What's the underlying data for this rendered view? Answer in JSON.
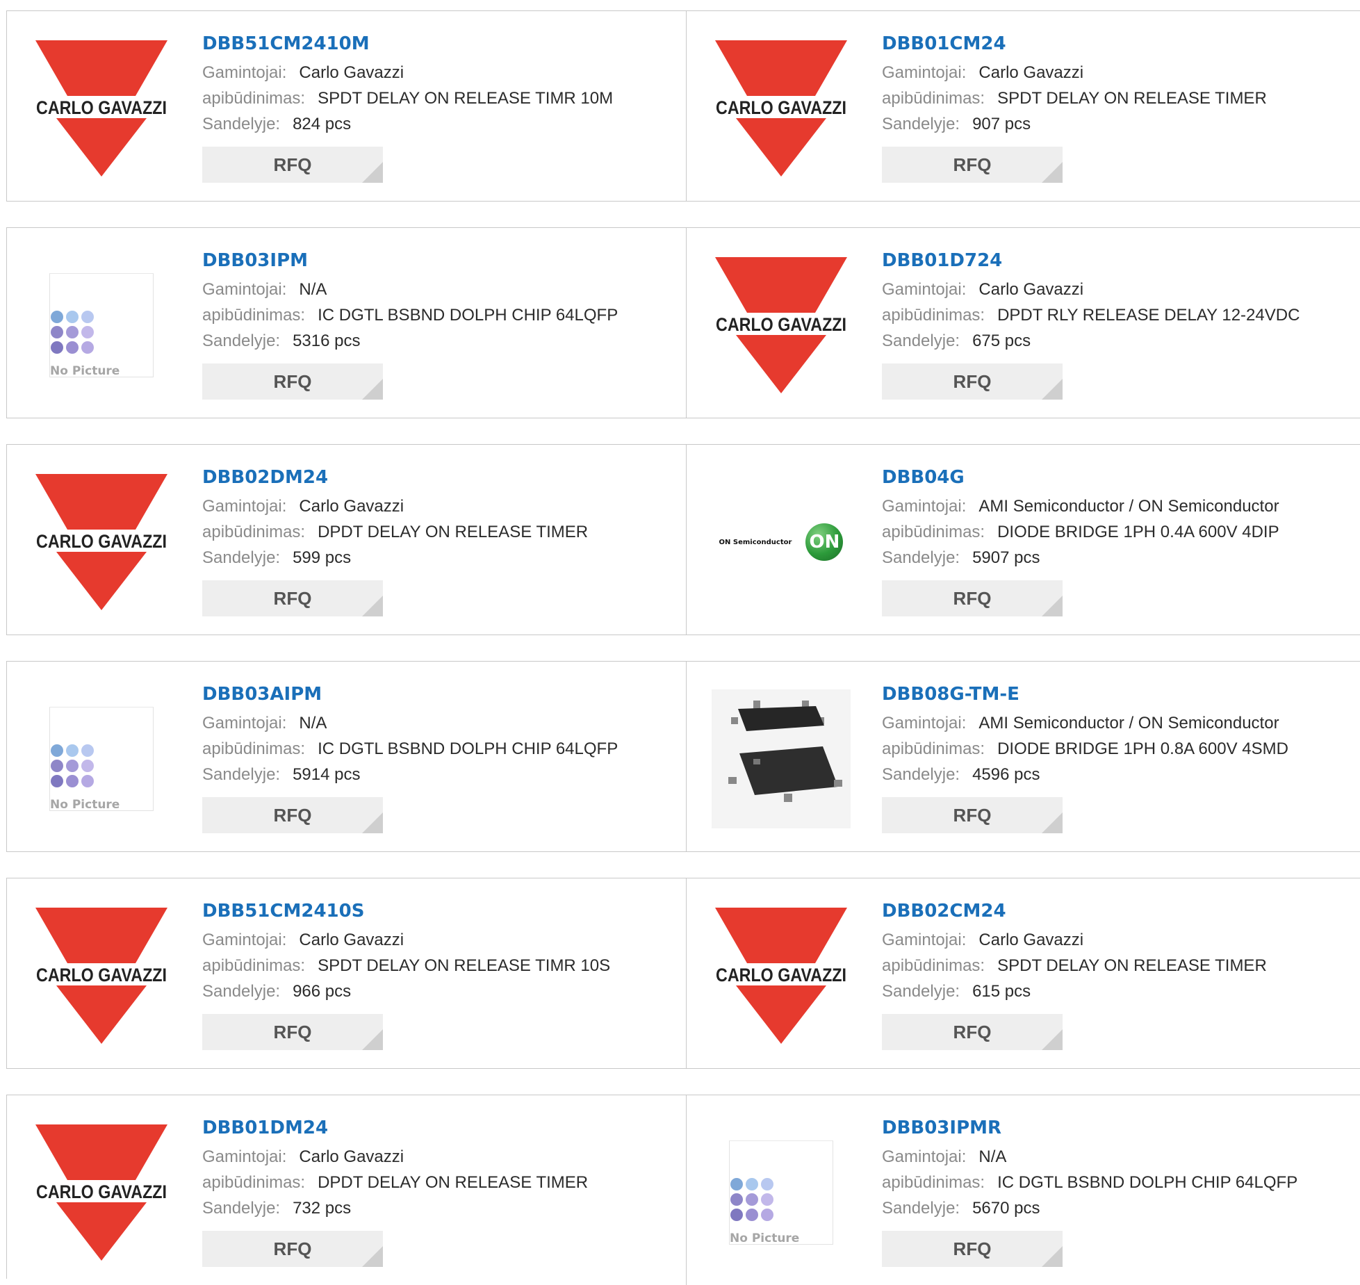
{
  "labels": {
    "manufacturer": "Gamintojai:",
    "description": "apibūdinimas:",
    "stock": "Sandelyje:",
    "rfq": "RFQ"
  },
  "logos": {
    "carlo_gavazzi": "CARLO GAVAZZI",
    "on_semi_text": "ON Semiconductor",
    "on_semi_ball": "ON",
    "no_picture": "No Picture"
  },
  "colors": {
    "part_link": "#1a6fb9",
    "carlo_red": "#e63a2e",
    "label_gray": "#8a8a8a"
  },
  "products": [
    {
      "pn": "DBB51CM2410M",
      "manufacturer": "Carlo Gavazzi",
      "description": "SPDT DELAY ON RELEASE TIMR 10M",
      "stock": "824 pcs",
      "image": "carlo-gavazzi-logo"
    },
    {
      "pn": "DBB01CM24",
      "manufacturer": "Carlo Gavazzi",
      "description": "SPDT DELAY ON RELEASE TIMER",
      "stock": "907 pcs",
      "image": "carlo-gavazzi-logo"
    },
    {
      "pn": "DBB03IPM",
      "manufacturer": "N/A",
      "description": "IC DGTL BSBND DOLPH CHIP 64LQFP",
      "stock": "5316 pcs",
      "image": "no-picture"
    },
    {
      "pn": "DBB01D724",
      "manufacturer": "Carlo Gavazzi",
      "description": "DPDT RLY RELEASE DELAY 12-24VDC",
      "stock": "675 pcs",
      "image": "carlo-gavazzi-logo"
    },
    {
      "pn": "DBB02DM24",
      "manufacturer": "Carlo Gavazzi",
      "description": "DPDT DELAY ON RELEASE TIMER",
      "stock": "599 pcs",
      "image": "carlo-gavazzi-logo"
    },
    {
      "pn": "DBB04G",
      "manufacturer": "AMI Semiconductor / ON Semiconductor",
      "description": "DIODE BRIDGE 1PH 0.4A 600V 4DIP",
      "stock": "5907 pcs",
      "image": "on-semi-logo"
    },
    {
      "pn": "DBB03AIPM",
      "manufacturer": "N/A",
      "description": "IC DGTL BSBND DOLPH CHIP 64LQFP",
      "stock": "5914 pcs",
      "image": "no-picture"
    },
    {
      "pn": "DBB08G-TM-E",
      "manufacturer": "AMI Semiconductor / ON Semiconductor",
      "description": "DIODE BRIDGE 1PH 0.8A 600V 4SMD",
      "stock": "4596 pcs",
      "image": "chip-photo"
    },
    {
      "pn": "DBB51CM2410S",
      "manufacturer": "Carlo Gavazzi",
      "description": "SPDT DELAY ON RELEASE TIMR 10S",
      "stock": "966 pcs",
      "image": "carlo-gavazzi-logo"
    },
    {
      "pn": "DBB02CM24",
      "manufacturer": "Carlo Gavazzi",
      "description": "SPDT DELAY ON RELEASE TIMER",
      "stock": "615 pcs",
      "image": "carlo-gavazzi-logo"
    },
    {
      "pn": "DBB01DM24",
      "manufacturer": "Carlo Gavazzi",
      "description": "DPDT DELAY ON RELEASE TIMER",
      "stock": "732 pcs",
      "image": "carlo-gavazzi-logo"
    },
    {
      "pn": "DBB03IPMR",
      "manufacturer": "N/A",
      "description": "IC DGTL BSBND DOLPH CHIP 64LQFP",
      "stock": "5670 pcs",
      "image": "no-picture"
    }
  ]
}
